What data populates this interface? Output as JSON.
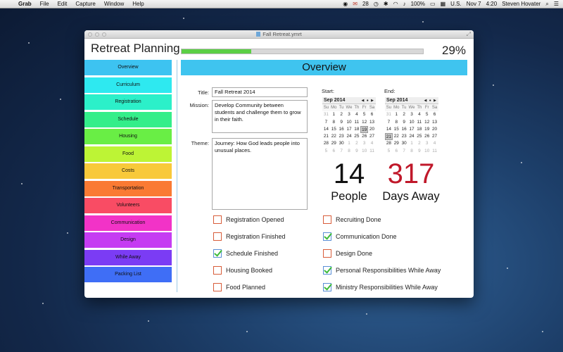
{
  "menubar": {
    "app_name": "Grab",
    "items": [
      "File",
      "Edit",
      "Capture",
      "Window",
      "Help"
    ],
    "mail_count": "28",
    "battery": "100%",
    "input_source": "U.S.",
    "date": "Nov 7",
    "time": "4:20",
    "user": "Steven Hovater"
  },
  "window": {
    "title": "Fall Retreat.ymrt",
    "app_title": "Retreat Planning",
    "progress": {
      "percent_label": "29%",
      "fraction": 0.29
    }
  },
  "sidebar": {
    "items": [
      {
        "label": "Overview",
        "color": "#3dc3f1"
      },
      {
        "label": "Curriculum",
        "color": "#2ee9f0"
      },
      {
        "label": "Registration",
        "color": "#2cf0c9"
      },
      {
        "label": "Schedule",
        "color": "#34ee8a"
      },
      {
        "label": "Housing",
        "color": "#69ee45"
      },
      {
        "label": "Food",
        "color": "#bdf435"
      },
      {
        "label": "Costs",
        "color": "#f8c93a"
      },
      {
        "label": "Transportation",
        "color": "#fa7a33"
      },
      {
        "label": "Volunteers",
        "color": "#f94c64"
      },
      {
        "label": "Communication",
        "color": "#f233c7"
      },
      {
        "label": "Design",
        "color": "#c53cf2"
      },
      {
        "label": "While Away",
        "color": "#7b3cf4"
      },
      {
        "label": "Packing List",
        "color": "#3f6ef6"
      }
    ]
  },
  "overview": {
    "header": "Overview",
    "title_label": "Title:",
    "title_value": "Fall Retreat 2014",
    "mission_label": "Mission:",
    "mission_value": "Develop Community between students and challenge them to grow in their faith.",
    "theme_label": "Theme:",
    "theme_value": "Journey: How God leads people into unusual places.",
    "start_label": "Start:",
    "end_label": "End:",
    "people_count": "14",
    "people_label": "People",
    "days_count": "317",
    "days_label": "Days Away",
    "days_color": "#c0182a"
  },
  "calendars": {
    "start": {
      "month": "Sep 2014",
      "nav": "◀ ● ▶",
      "dow": [
        "Su",
        "Mo",
        "Tu",
        "We",
        "Th",
        "Fr",
        "Sa"
      ],
      "weeks": [
        [
          "31",
          "1",
          "2",
          "3",
          "4",
          "5",
          "6"
        ],
        [
          "7",
          "8",
          "9",
          "10",
          "11",
          "12",
          "13"
        ],
        [
          "14",
          "15",
          "16",
          "17",
          "18",
          "19",
          "20"
        ],
        [
          "21",
          "22",
          "23",
          "24",
          "25",
          "26",
          "27"
        ],
        [
          "28",
          "29",
          "30",
          "1",
          "2",
          "3",
          "4"
        ],
        [
          "5",
          "6",
          "7",
          "8",
          "9",
          "10",
          "11"
        ]
      ],
      "selected": "19"
    },
    "end": {
      "month": "Sep 2014",
      "nav": "◀ ● ▶",
      "dow": [
        "Su",
        "Mo",
        "Tu",
        "We",
        "Th",
        "Fr",
        "Sa"
      ],
      "weeks": [
        [
          "31",
          "1",
          "2",
          "3",
          "4",
          "5",
          "6"
        ],
        [
          "7",
          "8",
          "9",
          "10",
          "11",
          "12",
          "13"
        ],
        [
          "14",
          "15",
          "16",
          "17",
          "18",
          "19",
          "20"
        ],
        [
          "21",
          "22",
          "23",
          "24",
          "25",
          "26",
          "27"
        ],
        [
          "28",
          "29",
          "30",
          "1",
          "2",
          "3",
          "4"
        ],
        [
          "5",
          "6",
          "7",
          "8",
          "9",
          "10",
          "11"
        ]
      ],
      "selected": "21"
    }
  },
  "checklist": {
    "left": [
      {
        "label": "Registration Opened",
        "checked": false
      },
      {
        "label": "Registration Finished",
        "checked": false
      },
      {
        "label": "Schedule Finished",
        "checked": true
      },
      {
        "label": "Housing Booked",
        "checked": false
      },
      {
        "label": "Food Planned",
        "checked": false
      }
    ],
    "right": [
      {
        "label": "Recruiting Done",
        "checked": false
      },
      {
        "label": "Communication Done",
        "checked": true
      },
      {
        "label": "Design Done",
        "checked": false
      },
      {
        "label": "Personal Responsibilities While Away",
        "checked": true
      },
      {
        "label": "Ministry Responsibilities While Away",
        "checked": true
      }
    ]
  }
}
